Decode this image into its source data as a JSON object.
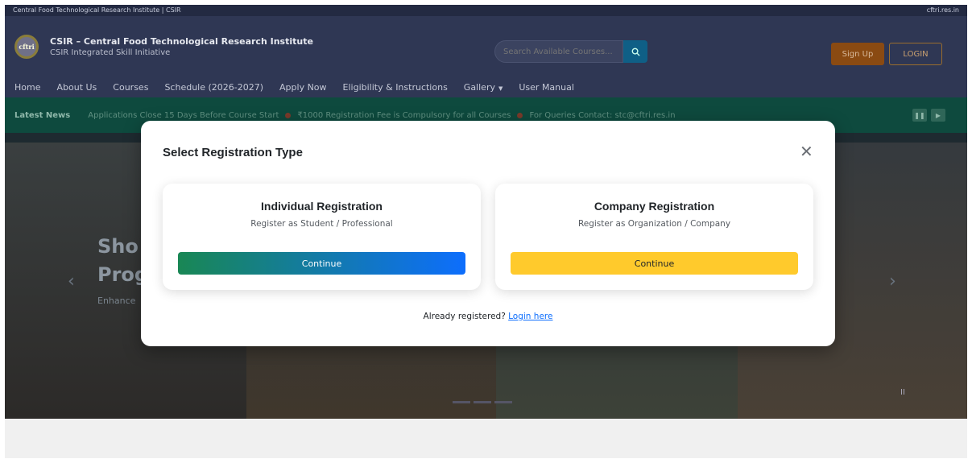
{
  "topbar": {
    "left": "Central Food Technological Research Institute | CSIR",
    "right": "cftri.res.in"
  },
  "header": {
    "logo_text": "cftri",
    "title": "CSIR – Central Food Technological Research Institute",
    "subtitle": "CSIR Integrated Skill Initiative",
    "search_placeholder": "Search Available Courses...",
    "signup_label": "Sign Up",
    "login_label": "LOGIN"
  },
  "nav": {
    "items": [
      {
        "label": "Home"
      },
      {
        "label": "About Us"
      },
      {
        "label": "Courses"
      },
      {
        "label": "Schedule (2026-2027)"
      },
      {
        "label": "Apply Now"
      },
      {
        "label": "Eligibility & Instructions"
      },
      {
        "label": "Gallery"
      },
      {
        "label": "User Manual"
      }
    ]
  },
  "ticker": {
    "label": "Latest News",
    "items": [
      "Applications Close 15 Days Before Course Start",
      "₹1000 Registration Fee is Compulsory for all Courses",
      "For Queries Contact: stc@cftri.res.in"
    ]
  },
  "hero": {
    "heading_line1": "Sho",
    "heading_line2": "Prog",
    "tagline": "Enhance"
  },
  "modal": {
    "title": "Select Registration Type",
    "individual": {
      "title": "Individual Registration",
      "subtitle": "Register as Student / Professional",
      "button": "Continue"
    },
    "company": {
      "title": "Company Registration",
      "subtitle": "Register as Organization / Company",
      "button": "Continue"
    },
    "footer_text": "Already registered?",
    "footer_link": "Login here"
  },
  "colors": {
    "individual_gradient_start": "#198754",
    "individual_gradient_end": "#0d6efd",
    "company_button": "#ffca2c",
    "link": "#0d6efd"
  }
}
